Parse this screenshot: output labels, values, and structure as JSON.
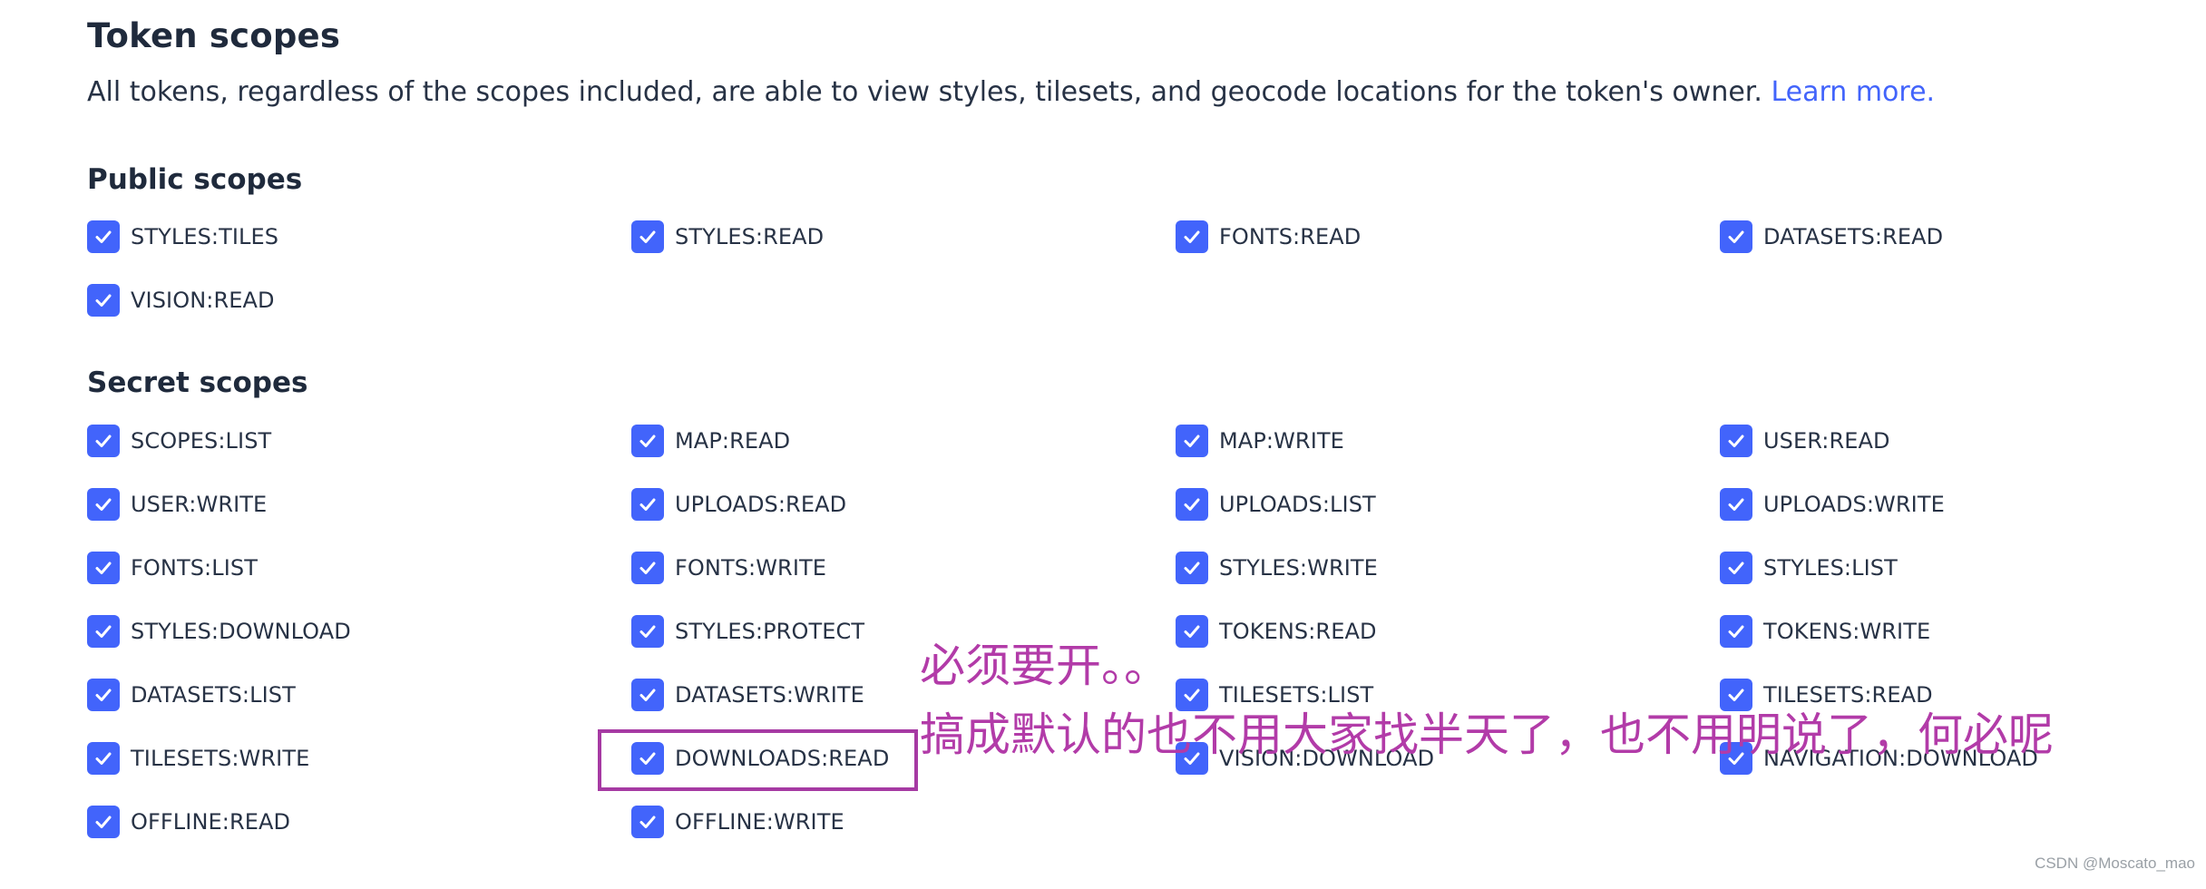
{
  "header": {
    "title": "Token scopes",
    "description": "All tokens, regardless of the scopes included, are able to view styles, tilesets, and geocode locations for the token's owner.",
    "learn_more": "Learn more."
  },
  "public_scopes": {
    "title": "Public scopes",
    "items": [
      {
        "label": "STYLES:TILES",
        "checked": true
      },
      {
        "label": "STYLES:READ",
        "checked": true
      },
      {
        "label": "FONTS:READ",
        "checked": true
      },
      {
        "label": "DATASETS:READ",
        "checked": true
      },
      {
        "label": "VISION:READ",
        "checked": true
      }
    ]
  },
  "secret_scopes": {
    "title": "Secret scopes",
    "items": [
      {
        "label": "SCOPES:LIST",
        "checked": true
      },
      {
        "label": "MAP:READ",
        "checked": true
      },
      {
        "label": "MAP:WRITE",
        "checked": true
      },
      {
        "label": "USER:READ",
        "checked": true
      },
      {
        "label": "USER:WRITE",
        "checked": true
      },
      {
        "label": "UPLOADS:READ",
        "checked": true
      },
      {
        "label": "UPLOADS:LIST",
        "checked": true
      },
      {
        "label": "UPLOADS:WRITE",
        "checked": true
      },
      {
        "label": "FONTS:LIST",
        "checked": true
      },
      {
        "label": "FONTS:WRITE",
        "checked": true
      },
      {
        "label": "STYLES:WRITE",
        "checked": true
      },
      {
        "label": "STYLES:LIST",
        "checked": true
      },
      {
        "label": "STYLES:DOWNLOAD",
        "checked": true
      },
      {
        "label": "STYLES:PROTECT",
        "checked": true
      },
      {
        "label": "TOKENS:READ",
        "checked": true
      },
      {
        "label": "TOKENS:WRITE",
        "checked": true
      },
      {
        "label": "DATASETS:LIST",
        "checked": true
      },
      {
        "label": "DATASETS:WRITE",
        "checked": true
      },
      {
        "label": "TILESETS:LIST",
        "checked": true
      },
      {
        "label": "TILESETS:READ",
        "checked": true
      },
      {
        "label": "TILESETS:WRITE",
        "checked": true
      },
      {
        "label": "DOWNLOADS:READ",
        "checked": true
      },
      {
        "label": "VISION:DOWNLOAD",
        "checked": true
      },
      {
        "label": "NAVIGATION:DOWNLOAD",
        "checked": true
      },
      {
        "label": "OFFLINE:READ",
        "checked": true
      },
      {
        "label": "OFFLINE:WRITE",
        "checked": true
      }
    ]
  },
  "annotation": {
    "line1": "必须要开。。",
    "line2": "搞成默认的也不用大家找半天了，也不用明说了，何必呢"
  },
  "watermark": "CSDN @Moscato_mao",
  "colors": {
    "accent": "#4264fb",
    "annotation": "#b23ba8",
    "highlight_border": "#a63aa3",
    "text": "#1f2a3c"
  },
  "icons": {
    "checkbox": "checkmark-icon"
  }
}
